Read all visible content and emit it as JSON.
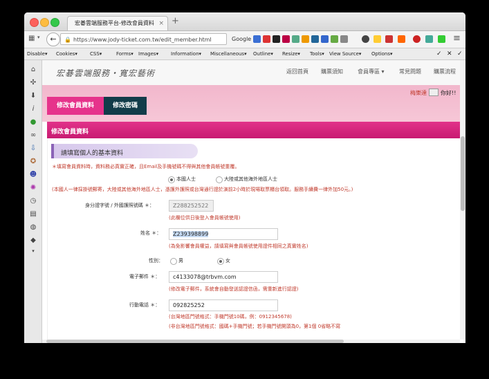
{
  "browser": {
    "tab_title": "宏碁雲端服務平台-修改會員資料",
    "tab_close": "×",
    "new_tab": "+",
    "url": "https://www.jody-ticket.com.tw/edit_member.html",
    "search_engine": "Google",
    "back_glyph": "←"
  },
  "devbar": {
    "items": [
      "Disable▾",
      "Cookies▾",
      "CSS▾",
      "Forms▾",
      "Images▾",
      "Information▾",
      "Miscellaneous▾",
      "Outline▾",
      "Resize▾",
      "Tools▾",
      "View Source▾",
      "Options▾"
    ],
    "right": [
      "✓",
      "✕",
      "✓"
    ]
  },
  "site": {
    "brand": "宏碁雲端服務・寬宏藝術",
    "nav": [
      "返回首頁",
      "購票須知",
      "會員專區 ▾",
      "常見問題",
      "購票流程"
    ],
    "user_name": "梅樂達",
    "greeting": "你好!!"
  },
  "tabs": {
    "edit_profile": "修改會員資料",
    "change_password": "修改密碼"
  },
  "form": {
    "bar_title": "修改會員資料",
    "section_title": "請填寫個人的基本資料",
    "required_note": "＊填寫會員資料時，資料務必真實正確，且Email及手機號碼不得與其他會員帳號重覆。",
    "nationality": {
      "option_local": "本國人士",
      "option_foreign": "大陸或其他海外地區人士",
      "selected": "本國人士",
      "note": "(本國人一律採掛號郵寄，大陸或其他海外地區人士，憑護外護照或台灣通行證於演前2小時於現場取票櫃台領取。服務手續費一律外加50元。)"
    },
    "id_number": {
      "label": "身分證字號 / 外國護照號碼 ＊：",
      "value": "Z288252522",
      "hint": "(此欄位供日後登入會員帳號使用)"
    },
    "name": {
      "label": "姓名 ＊：",
      "value": "Z239398899",
      "hint": "(為免影響會員權益，請填寫與會員帳號使用證件相同之真實姓名)"
    },
    "gender": {
      "label": "性別：",
      "male": "男",
      "female": "女",
      "selected": "女"
    },
    "email": {
      "label": "電子郵件 ＊：",
      "value": "c4133078@trbvm.com",
      "hint": "(修改電子郵件，系統會自動發送認證信函，需重新進行認證)"
    },
    "mobile": {
      "label": "行動電話 ＊：",
      "value": "092825252",
      "hint1": "(台灣地區門號格式：手機門號10碼，例：0912345678)",
      "hint2": "(非台灣地區門號格式：國碼+手機門號；若手機門號開頭為0，第1個 0省略不寫"
    }
  }
}
